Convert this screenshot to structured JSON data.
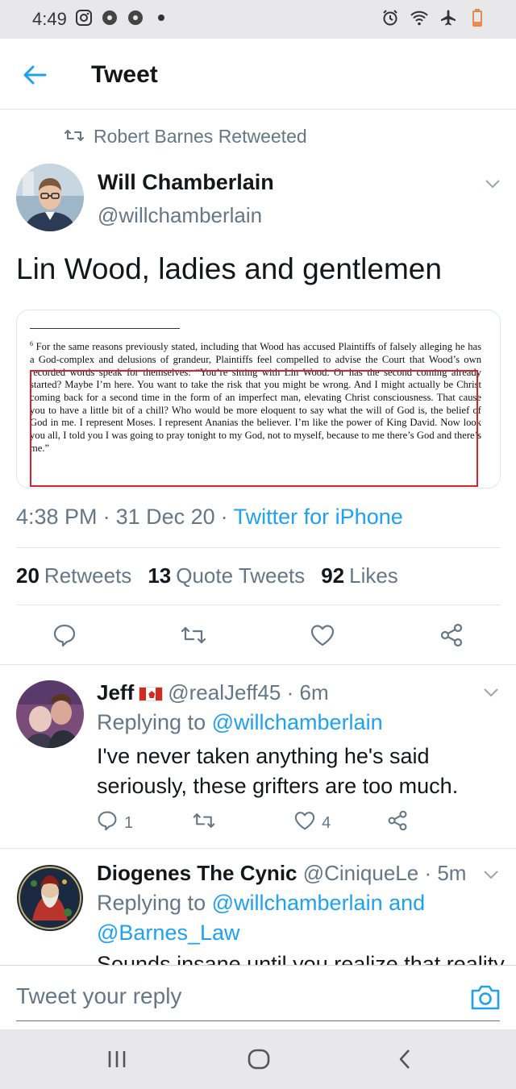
{
  "status_bar": {
    "time": "4:49"
  },
  "header": {
    "title": "Tweet"
  },
  "retweet": {
    "label": "Robert Barnes Retweeted"
  },
  "tweet": {
    "author_name": "Will Chamberlain",
    "author_handle": "@willchamberlain",
    "text": "Lin Wood, ladies and gentlemen",
    "time": "4:38 PM",
    "date": "31 Dec 20",
    "source": "Twitter for iPhone",
    "media": {
      "footnote_number": "6",
      "footnote_text": "For the same reasons previously stated, including that Wood has accused Plaintiffs of falsely alleging he has a God-complex and delusions of grandeur, Plaintiffs feel compelled to advise the Court that Wood’s own recorded words speak for themselves: “You’re sitting with Lin Wood. Or has the second coming already started? Maybe I’m here. You want to take the risk that you might be wrong. And I might actually be Christ coming back for a second time in the form of an imperfect man, elevating Christ consciousness. That cause you to have a little bit of a chill? Who would be more eloquent to say what the will of God is, the belief of God in me. I represent Moses. I represent Ananias the believer. I’m like the power of King David. Now look you all, I told you I was going to pray tonight to my God, not to myself, because to me there’s God and there’s me.”"
    },
    "stats": {
      "retweets_count": "20",
      "retweets_label": "Retweets",
      "quotes_count": "13",
      "quotes_label": "Quote Tweets",
      "likes_count": "92",
      "likes_label": "Likes"
    }
  },
  "replies": [
    {
      "name": "Jeff",
      "handle": "@realJeff45",
      "time": "6m",
      "replying_label": "Replying to",
      "replying_to": "@willchamberlain",
      "text": "I've never taken anything he's said seriously, these grifters are too much.",
      "reply_count": "1",
      "like_count": "4"
    },
    {
      "name": "Diogenes The Cynic",
      "handle": "@CiniqueLe",
      "time": "5m",
      "replying_label": "Replying to",
      "replying_to": "@willchamberlain",
      "replying_and": "and",
      "replying_to_2": "@Barnes_Law",
      "text": "Sounds insane until you realize that reality"
    }
  ],
  "reply_box": {
    "placeholder": "Tweet your reply"
  },
  "colors": {
    "accent": "#1da1f2",
    "muted": "#657786",
    "highlight_box": "#d4232d"
  }
}
